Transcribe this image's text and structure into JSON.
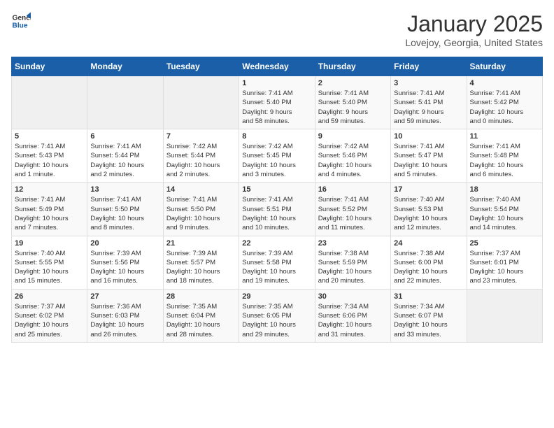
{
  "logo": {
    "general": "General",
    "blue": "Blue"
  },
  "title": "January 2025",
  "subtitle": "Lovejoy, Georgia, United States",
  "days_of_week": [
    "Sunday",
    "Monday",
    "Tuesday",
    "Wednesday",
    "Thursday",
    "Friday",
    "Saturday"
  ],
  "weeks": [
    [
      {
        "day": "",
        "info": ""
      },
      {
        "day": "",
        "info": ""
      },
      {
        "day": "",
        "info": ""
      },
      {
        "day": "1",
        "info": "Sunrise: 7:41 AM\nSunset: 5:40 PM\nDaylight: 9 hours\nand 58 minutes."
      },
      {
        "day": "2",
        "info": "Sunrise: 7:41 AM\nSunset: 5:40 PM\nDaylight: 9 hours\nand 59 minutes."
      },
      {
        "day": "3",
        "info": "Sunrise: 7:41 AM\nSunset: 5:41 PM\nDaylight: 9 hours\nand 59 minutes."
      },
      {
        "day": "4",
        "info": "Sunrise: 7:41 AM\nSunset: 5:42 PM\nDaylight: 10 hours\nand 0 minutes."
      }
    ],
    [
      {
        "day": "5",
        "info": "Sunrise: 7:41 AM\nSunset: 5:43 PM\nDaylight: 10 hours\nand 1 minute."
      },
      {
        "day": "6",
        "info": "Sunrise: 7:41 AM\nSunset: 5:44 PM\nDaylight: 10 hours\nand 2 minutes."
      },
      {
        "day": "7",
        "info": "Sunrise: 7:42 AM\nSunset: 5:44 PM\nDaylight: 10 hours\nand 2 minutes."
      },
      {
        "day": "8",
        "info": "Sunrise: 7:42 AM\nSunset: 5:45 PM\nDaylight: 10 hours\nand 3 minutes."
      },
      {
        "day": "9",
        "info": "Sunrise: 7:42 AM\nSunset: 5:46 PM\nDaylight: 10 hours\nand 4 minutes."
      },
      {
        "day": "10",
        "info": "Sunrise: 7:41 AM\nSunset: 5:47 PM\nDaylight: 10 hours\nand 5 minutes."
      },
      {
        "day": "11",
        "info": "Sunrise: 7:41 AM\nSunset: 5:48 PM\nDaylight: 10 hours\nand 6 minutes."
      }
    ],
    [
      {
        "day": "12",
        "info": "Sunrise: 7:41 AM\nSunset: 5:49 PM\nDaylight: 10 hours\nand 7 minutes."
      },
      {
        "day": "13",
        "info": "Sunrise: 7:41 AM\nSunset: 5:50 PM\nDaylight: 10 hours\nand 8 minutes."
      },
      {
        "day": "14",
        "info": "Sunrise: 7:41 AM\nSunset: 5:50 PM\nDaylight: 10 hours\nand 9 minutes."
      },
      {
        "day": "15",
        "info": "Sunrise: 7:41 AM\nSunset: 5:51 PM\nDaylight: 10 hours\nand 10 minutes."
      },
      {
        "day": "16",
        "info": "Sunrise: 7:41 AM\nSunset: 5:52 PM\nDaylight: 10 hours\nand 11 minutes."
      },
      {
        "day": "17",
        "info": "Sunrise: 7:40 AM\nSunset: 5:53 PM\nDaylight: 10 hours\nand 12 minutes."
      },
      {
        "day": "18",
        "info": "Sunrise: 7:40 AM\nSunset: 5:54 PM\nDaylight: 10 hours\nand 14 minutes."
      }
    ],
    [
      {
        "day": "19",
        "info": "Sunrise: 7:40 AM\nSunset: 5:55 PM\nDaylight: 10 hours\nand 15 minutes."
      },
      {
        "day": "20",
        "info": "Sunrise: 7:39 AM\nSunset: 5:56 PM\nDaylight: 10 hours\nand 16 minutes."
      },
      {
        "day": "21",
        "info": "Sunrise: 7:39 AM\nSunset: 5:57 PM\nDaylight: 10 hours\nand 18 minutes."
      },
      {
        "day": "22",
        "info": "Sunrise: 7:39 AM\nSunset: 5:58 PM\nDaylight: 10 hours\nand 19 minutes."
      },
      {
        "day": "23",
        "info": "Sunrise: 7:38 AM\nSunset: 5:59 PM\nDaylight: 10 hours\nand 20 minutes."
      },
      {
        "day": "24",
        "info": "Sunrise: 7:38 AM\nSunset: 6:00 PM\nDaylight: 10 hours\nand 22 minutes."
      },
      {
        "day": "25",
        "info": "Sunrise: 7:37 AM\nSunset: 6:01 PM\nDaylight: 10 hours\nand 23 minutes."
      }
    ],
    [
      {
        "day": "26",
        "info": "Sunrise: 7:37 AM\nSunset: 6:02 PM\nDaylight: 10 hours\nand 25 minutes."
      },
      {
        "day": "27",
        "info": "Sunrise: 7:36 AM\nSunset: 6:03 PM\nDaylight: 10 hours\nand 26 minutes."
      },
      {
        "day": "28",
        "info": "Sunrise: 7:35 AM\nSunset: 6:04 PM\nDaylight: 10 hours\nand 28 minutes."
      },
      {
        "day": "29",
        "info": "Sunrise: 7:35 AM\nSunset: 6:05 PM\nDaylight: 10 hours\nand 29 minutes."
      },
      {
        "day": "30",
        "info": "Sunrise: 7:34 AM\nSunset: 6:06 PM\nDaylight: 10 hours\nand 31 minutes."
      },
      {
        "day": "31",
        "info": "Sunrise: 7:34 AM\nSunset: 6:07 PM\nDaylight: 10 hours\nand 33 minutes."
      },
      {
        "day": "",
        "info": ""
      }
    ]
  ]
}
